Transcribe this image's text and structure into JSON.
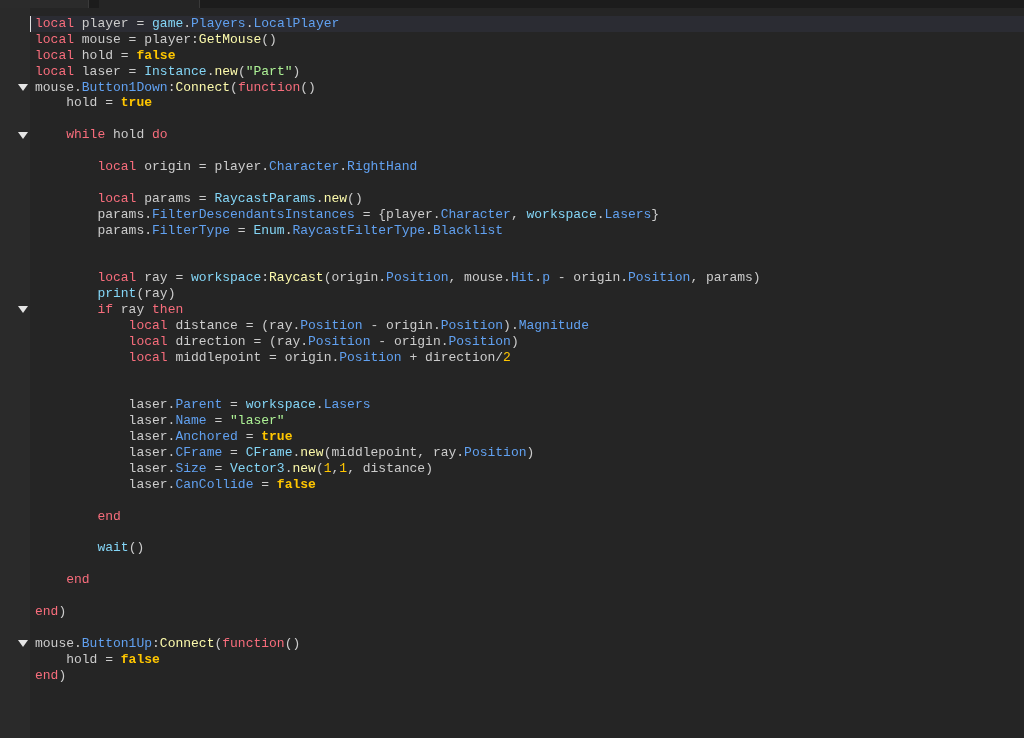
{
  "tabs": [
    {
      "selected": false
    },
    {
      "selected": true
    }
  ],
  "lines": [
    {
      "kind": "code",
      "current": true,
      "tokens": [
        {
          "kind": "kw",
          "t": "local"
        },
        {
          "kind": "p",
          "t": " player = "
        },
        {
          "kind": "glob",
          "t": "game"
        },
        {
          "kind": "p",
          "t": "."
        },
        {
          "kind": "mem",
          "t": "Players"
        },
        {
          "kind": "p",
          "t": "."
        },
        {
          "kind": "mem",
          "t": "LocalPlayer"
        }
      ]
    },
    {
      "kind": "code",
      "current": false,
      "tokens": [
        {
          "kind": "kw",
          "t": "local"
        },
        {
          "kind": "p",
          "t": " mouse = player:"
        },
        {
          "kind": "fn",
          "t": "GetMouse"
        },
        {
          "kind": "p",
          "t": "()"
        }
      ]
    },
    {
      "kind": "code",
      "current": false,
      "tokens": [
        {
          "kind": "kw",
          "t": "local"
        },
        {
          "kind": "p",
          "t": " hold = "
        },
        {
          "kind": "lit",
          "t": "false"
        }
      ]
    },
    {
      "kind": "code",
      "current": false,
      "tokens": [
        {
          "kind": "kw",
          "t": "local"
        },
        {
          "kind": "p",
          "t": " laser = "
        },
        {
          "kind": "glob",
          "t": "Instance"
        },
        {
          "kind": "p",
          "t": "."
        },
        {
          "kind": "fn",
          "t": "new"
        },
        {
          "kind": "p",
          "t": "("
        },
        {
          "kind": "str",
          "t": "\"Part\""
        },
        {
          "kind": "p",
          "t": ")"
        }
      ]
    },
    {
      "kind": "code",
      "current": false,
      "expanded": true,
      "tokens": [
        {
          "kind": "p",
          "t": "mouse."
        },
        {
          "kind": "mem",
          "t": "Button1Down"
        },
        {
          "kind": "p",
          "t": ":"
        },
        {
          "kind": "fn",
          "t": "Connect"
        },
        {
          "kind": "p",
          "t": "("
        },
        {
          "kind": "kw",
          "t": "function"
        },
        {
          "kind": "p",
          "t": "()"
        }
      ],
      "children": [
        {
          "kind": "code",
          "current": false,
          "tokens": [
            {
              "kind": "p",
              "t": "hold = "
            },
            {
              "kind": "lit",
              "t": "true"
            }
          ]
        },
        {
          "kind": "blank"
        },
        {
          "kind": "code",
          "current": false,
          "expanded": true,
          "tokens": [
            {
              "kind": "kw",
              "t": "while"
            },
            {
              "kind": "p",
              "t": " hold "
            },
            {
              "kind": "kw",
              "t": "do"
            }
          ],
          "children": [
            {
              "kind": "blank"
            },
            {
              "kind": "code",
              "current": false,
              "tokens": [
                {
                  "kind": "kw",
                  "t": "local"
                },
                {
                  "kind": "p",
                  "t": " origin = player."
                },
                {
                  "kind": "mem",
                  "t": "Character"
                },
                {
                  "kind": "p",
                  "t": "."
                },
                {
                  "kind": "mem",
                  "t": "RightHand"
                }
              ]
            },
            {
              "kind": "blank"
            },
            {
              "kind": "code",
              "current": false,
              "tokens": [
                {
                  "kind": "kw",
                  "t": "local"
                },
                {
                  "kind": "p",
                  "t": " params = "
                },
                {
                  "kind": "glob",
                  "t": "RaycastParams"
                },
                {
                  "kind": "p",
                  "t": "."
                },
                {
                  "kind": "fn",
                  "t": "new"
                },
                {
                  "kind": "p",
                  "t": "()"
                }
              ]
            },
            {
              "kind": "code",
              "current": false,
              "tokens": [
                {
                  "kind": "p",
                  "t": "params."
                },
                {
                  "kind": "mem",
                  "t": "FilterDescendantsInstances"
                },
                {
                  "kind": "p",
                  "t": " = {player."
                },
                {
                  "kind": "mem",
                  "t": "Character"
                },
                {
                  "kind": "p",
                  "t": ", "
                },
                {
                  "kind": "glob",
                  "t": "workspace"
                },
                {
                  "kind": "p",
                  "t": "."
                },
                {
                  "kind": "mem",
                  "t": "Lasers"
                },
                {
                  "kind": "p",
                  "t": "}"
                }
              ]
            },
            {
              "kind": "code",
              "current": false,
              "tokens": [
                {
                  "kind": "p",
                  "t": "params."
                },
                {
                  "kind": "mem",
                  "t": "FilterType"
                },
                {
                  "kind": "p",
                  "t": " = "
                },
                {
                  "kind": "glob",
                  "t": "Enum"
                },
                {
                  "kind": "p",
                  "t": "."
                },
                {
                  "kind": "mem",
                  "t": "RaycastFilterType"
                },
                {
                  "kind": "p",
                  "t": "."
                },
                {
                  "kind": "mem",
                  "t": "Blacklist"
                }
              ]
            },
            {
              "kind": "blank"
            },
            {
              "kind": "blank"
            },
            {
              "kind": "code",
              "current": false,
              "tokens": [
                {
                  "kind": "kw",
                  "t": "local"
                },
                {
                  "kind": "p",
                  "t": " ray = "
                },
                {
                  "kind": "glob",
                  "t": "workspace"
                },
                {
                  "kind": "p",
                  "t": ":"
                },
                {
                  "kind": "fn",
                  "t": "Raycast"
                },
                {
                  "kind": "p",
                  "t": "(origin."
                },
                {
                  "kind": "mem",
                  "t": "Position"
                },
                {
                  "kind": "p",
                  "t": ", mouse."
                },
                {
                  "kind": "mem",
                  "t": "Hit"
                },
                {
                  "kind": "p",
                  "t": "."
                },
                {
                  "kind": "mem",
                  "t": "p"
                },
                {
                  "kind": "p",
                  "t": " - origin."
                },
                {
                  "kind": "mem",
                  "t": "Position"
                },
                {
                  "kind": "p",
                  "t": ", params)"
                }
              ]
            },
            {
              "kind": "code",
              "current": false,
              "tokens": [
                {
                  "kind": "glob",
                  "t": "print"
                },
                {
                  "kind": "p",
                  "t": "(ray)"
                }
              ]
            },
            {
              "kind": "code",
              "current": false,
              "expanded": true,
              "tokens": [
                {
                  "kind": "kw",
                  "t": "if"
                },
                {
                  "kind": "p",
                  "t": " ray "
                },
                {
                  "kind": "kw",
                  "t": "then"
                }
              ],
              "children": [
                {
                  "kind": "code",
                  "current": false,
                  "tokens": [
                    {
                      "kind": "kw",
                      "t": "local"
                    },
                    {
                      "kind": "p",
                      "t": " distance = (ray."
                    },
                    {
                      "kind": "mem",
                      "t": "Position"
                    },
                    {
                      "kind": "p",
                      "t": " - origin."
                    },
                    {
                      "kind": "mem",
                      "t": "Position"
                    },
                    {
                      "kind": "p",
                      "t": ")."
                    },
                    {
                      "kind": "mem",
                      "t": "Magnitude"
                    }
                  ]
                },
                {
                  "kind": "code",
                  "current": false,
                  "tokens": [
                    {
                      "kind": "kw",
                      "t": "local"
                    },
                    {
                      "kind": "p",
                      "t": " direction = (ray."
                    },
                    {
                      "kind": "mem",
                      "t": "Position"
                    },
                    {
                      "kind": "p",
                      "t": " - origin."
                    },
                    {
                      "kind": "mem",
                      "t": "Position"
                    },
                    {
                      "kind": "p",
                      "t": ")"
                    }
                  ]
                },
                {
                  "kind": "code",
                  "current": false,
                  "tokens": [
                    {
                      "kind": "kw",
                      "t": "local"
                    },
                    {
                      "kind": "p",
                      "t": " middlepoint = origin."
                    },
                    {
                      "kind": "mem",
                      "t": "Position"
                    },
                    {
                      "kind": "p",
                      "t": " + direction/"
                    },
                    {
                      "kind": "num",
                      "t": "2"
                    }
                  ]
                },
                {
                  "kind": "blank"
                },
                {
                  "kind": "blank"
                },
                {
                  "kind": "code",
                  "current": false,
                  "tokens": [
                    {
                      "kind": "p",
                      "t": "laser."
                    },
                    {
                      "kind": "mem",
                      "t": "Parent"
                    },
                    {
                      "kind": "p",
                      "t": " = "
                    },
                    {
                      "kind": "glob",
                      "t": "workspace"
                    },
                    {
                      "kind": "p",
                      "t": "."
                    },
                    {
                      "kind": "mem",
                      "t": "Lasers"
                    }
                  ]
                },
                {
                  "kind": "code",
                  "current": false,
                  "tokens": [
                    {
                      "kind": "p",
                      "t": "laser."
                    },
                    {
                      "kind": "mem",
                      "t": "Name"
                    },
                    {
                      "kind": "p",
                      "t": " = "
                    },
                    {
                      "kind": "str",
                      "t": "\"laser\""
                    }
                  ]
                },
                {
                  "kind": "code",
                  "current": false,
                  "tokens": [
                    {
                      "kind": "p",
                      "t": "laser."
                    },
                    {
                      "kind": "mem",
                      "t": "Anchored"
                    },
                    {
                      "kind": "p",
                      "t": " = "
                    },
                    {
                      "kind": "lit",
                      "t": "true"
                    }
                  ]
                },
                {
                  "kind": "code",
                  "current": false,
                  "tokens": [
                    {
                      "kind": "p",
                      "t": "laser."
                    },
                    {
                      "kind": "mem",
                      "t": "CFrame"
                    },
                    {
                      "kind": "p",
                      "t": " = "
                    },
                    {
                      "kind": "glob",
                      "t": "CFrame"
                    },
                    {
                      "kind": "p",
                      "t": "."
                    },
                    {
                      "kind": "fn",
                      "t": "new"
                    },
                    {
                      "kind": "p",
                      "t": "(middlepoint, ray."
                    },
                    {
                      "kind": "mem",
                      "t": "Position"
                    },
                    {
                      "kind": "p",
                      "t": ")"
                    }
                  ]
                },
                {
                  "kind": "code",
                  "current": false,
                  "tokens": [
                    {
                      "kind": "p",
                      "t": "laser."
                    },
                    {
                      "kind": "mem",
                      "t": "Size"
                    },
                    {
                      "kind": "p",
                      "t": " = "
                    },
                    {
                      "kind": "glob",
                      "t": "Vector3"
                    },
                    {
                      "kind": "p",
                      "t": "."
                    },
                    {
                      "kind": "fn",
                      "t": "new"
                    },
                    {
                      "kind": "p",
                      "t": "("
                    },
                    {
                      "kind": "num",
                      "t": "1"
                    },
                    {
                      "kind": "p",
                      "t": ","
                    },
                    {
                      "kind": "num",
                      "t": "1"
                    },
                    {
                      "kind": "p",
                      "t": ", distance)"
                    }
                  ]
                },
                {
                  "kind": "code",
                  "current": false,
                  "tokens": [
                    {
                      "kind": "p",
                      "t": "laser."
                    },
                    {
                      "kind": "mem",
                      "t": "CanCollide"
                    },
                    {
                      "kind": "p",
                      "t": " = "
                    },
                    {
                      "kind": "lit",
                      "t": "false"
                    }
                  ]
                },
                {
                  "kind": "blank"
                }
              ]
            },
            {
              "kind": "code",
              "current": false,
              "tokens": [
                {
                  "kind": "kw",
                  "t": "end"
                }
              ]
            },
            {
              "kind": "blank"
            },
            {
              "kind": "code",
              "current": false,
              "tokens": [
                {
                  "kind": "glob",
                  "t": "wait"
                },
                {
                  "kind": "p",
                  "t": "()"
                }
              ]
            },
            {
              "kind": "blank"
            }
          ]
        },
        {
          "kind": "code",
          "current": false,
          "tokens": [
            {
              "kind": "kw",
              "t": "end"
            }
          ]
        },
        {
          "kind": "blank"
        }
      ]
    },
    {
      "kind": "code",
      "current": false,
      "tokens": [
        {
          "kind": "kw",
          "t": "end"
        },
        {
          "kind": "p",
          "t": ")"
        }
      ]
    },
    {
      "kind": "blank"
    },
    {
      "kind": "code",
      "current": false,
      "expanded": true,
      "tokens": [
        {
          "kind": "p",
          "t": "mouse."
        },
        {
          "kind": "mem",
          "t": "Button1Up"
        },
        {
          "kind": "p",
          "t": ":"
        },
        {
          "kind": "fn",
          "t": "Connect"
        },
        {
          "kind": "p",
          "t": "("
        },
        {
          "kind": "kw",
          "t": "function"
        },
        {
          "kind": "p",
          "t": "()"
        }
      ],
      "children": [
        {
          "kind": "code",
          "current": false,
          "tokens": [
            {
              "kind": "p",
              "t": "hold = "
            },
            {
              "kind": "lit",
              "t": "false"
            }
          ]
        }
      ]
    },
    {
      "kind": "code",
      "current": false,
      "tokens": [
        {
          "kind": "kw",
          "t": "end"
        },
        {
          "kind": "p",
          "t": ")"
        }
      ]
    }
  ]
}
